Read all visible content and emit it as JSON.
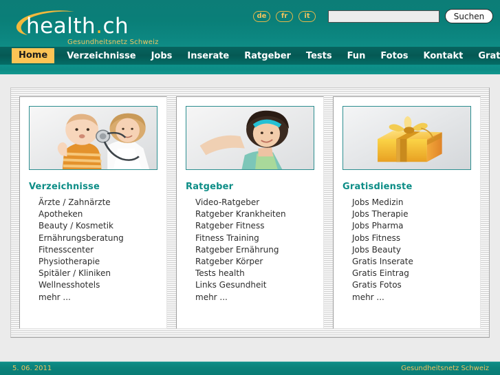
{
  "header": {
    "logo_text": "health",
    "logo_dot": ".",
    "logo_suffix": "ch",
    "tagline": "Gesundheitsnetz Schweiz",
    "languages": [
      {
        "code": "de"
      },
      {
        "code": "fr"
      },
      {
        "code": "it"
      }
    ],
    "search": {
      "value": "",
      "placeholder": "",
      "button_label": "Suchen"
    }
  },
  "nav": {
    "items": [
      {
        "label": "Home",
        "active": true
      },
      {
        "label": "Verzeichnisse",
        "active": false
      },
      {
        "label": "Jobs",
        "active": false
      },
      {
        "label": "Inserate",
        "active": false
      },
      {
        "label": "Ratgeber",
        "active": false
      },
      {
        "label": "Tests",
        "active": false
      },
      {
        "label": "Fun",
        "active": false
      },
      {
        "label": "Fotos",
        "active": false
      },
      {
        "label": "Kontakt",
        "active": false
      },
      {
        "label": "Gratis",
        "active": false
      }
    ]
  },
  "main": {
    "cards": [
      {
        "photo": "baby-and-doctor-photo",
        "title": "Verzeichnisse",
        "links": [
          "Ärzte / Zahnärzte",
          "Apotheken",
          "Beauty / Kosmetik",
          "Ernährungsberatung",
          "Fitnesscenter",
          "Physiotherapie",
          "Spitäler / Kliniken",
          "Wellnesshotels",
          "mehr ..."
        ]
      },
      {
        "photo": "woman-fitness-photo",
        "title": "Ratgeber",
        "links": [
          "Video-Ratgeber",
          "Ratgeber Krankheiten",
          "Ratgeber Fitness",
          "Fitness Training",
          "Ratgeber Ernährung",
          "Ratgeber Körper",
          "Tests health",
          "Links Gesundheit",
          "mehr ..."
        ]
      },
      {
        "photo": "gift-box-photo",
        "title": "Gratisdienste",
        "links": [
          "Jobs Medizin",
          "Jobs Therapie",
          "Jobs Pharma",
          "Jobs Fitness",
          "Jobs Beauty",
          "Gratis Inserate",
          "Gratis Eintrag",
          "Gratis Fotos",
          "mehr ..."
        ]
      }
    ]
  },
  "footer": {
    "date": "5. 06. 2011",
    "tagline": "Gesundheitsnetz Schweiz"
  },
  "colors": {
    "teal": "#0a7f78",
    "teal_dark": "#055954",
    "gold": "#fcc455",
    "gold_text": "#f0c563",
    "heading": "#0c8d86",
    "page_bg": "#ebebeb"
  }
}
